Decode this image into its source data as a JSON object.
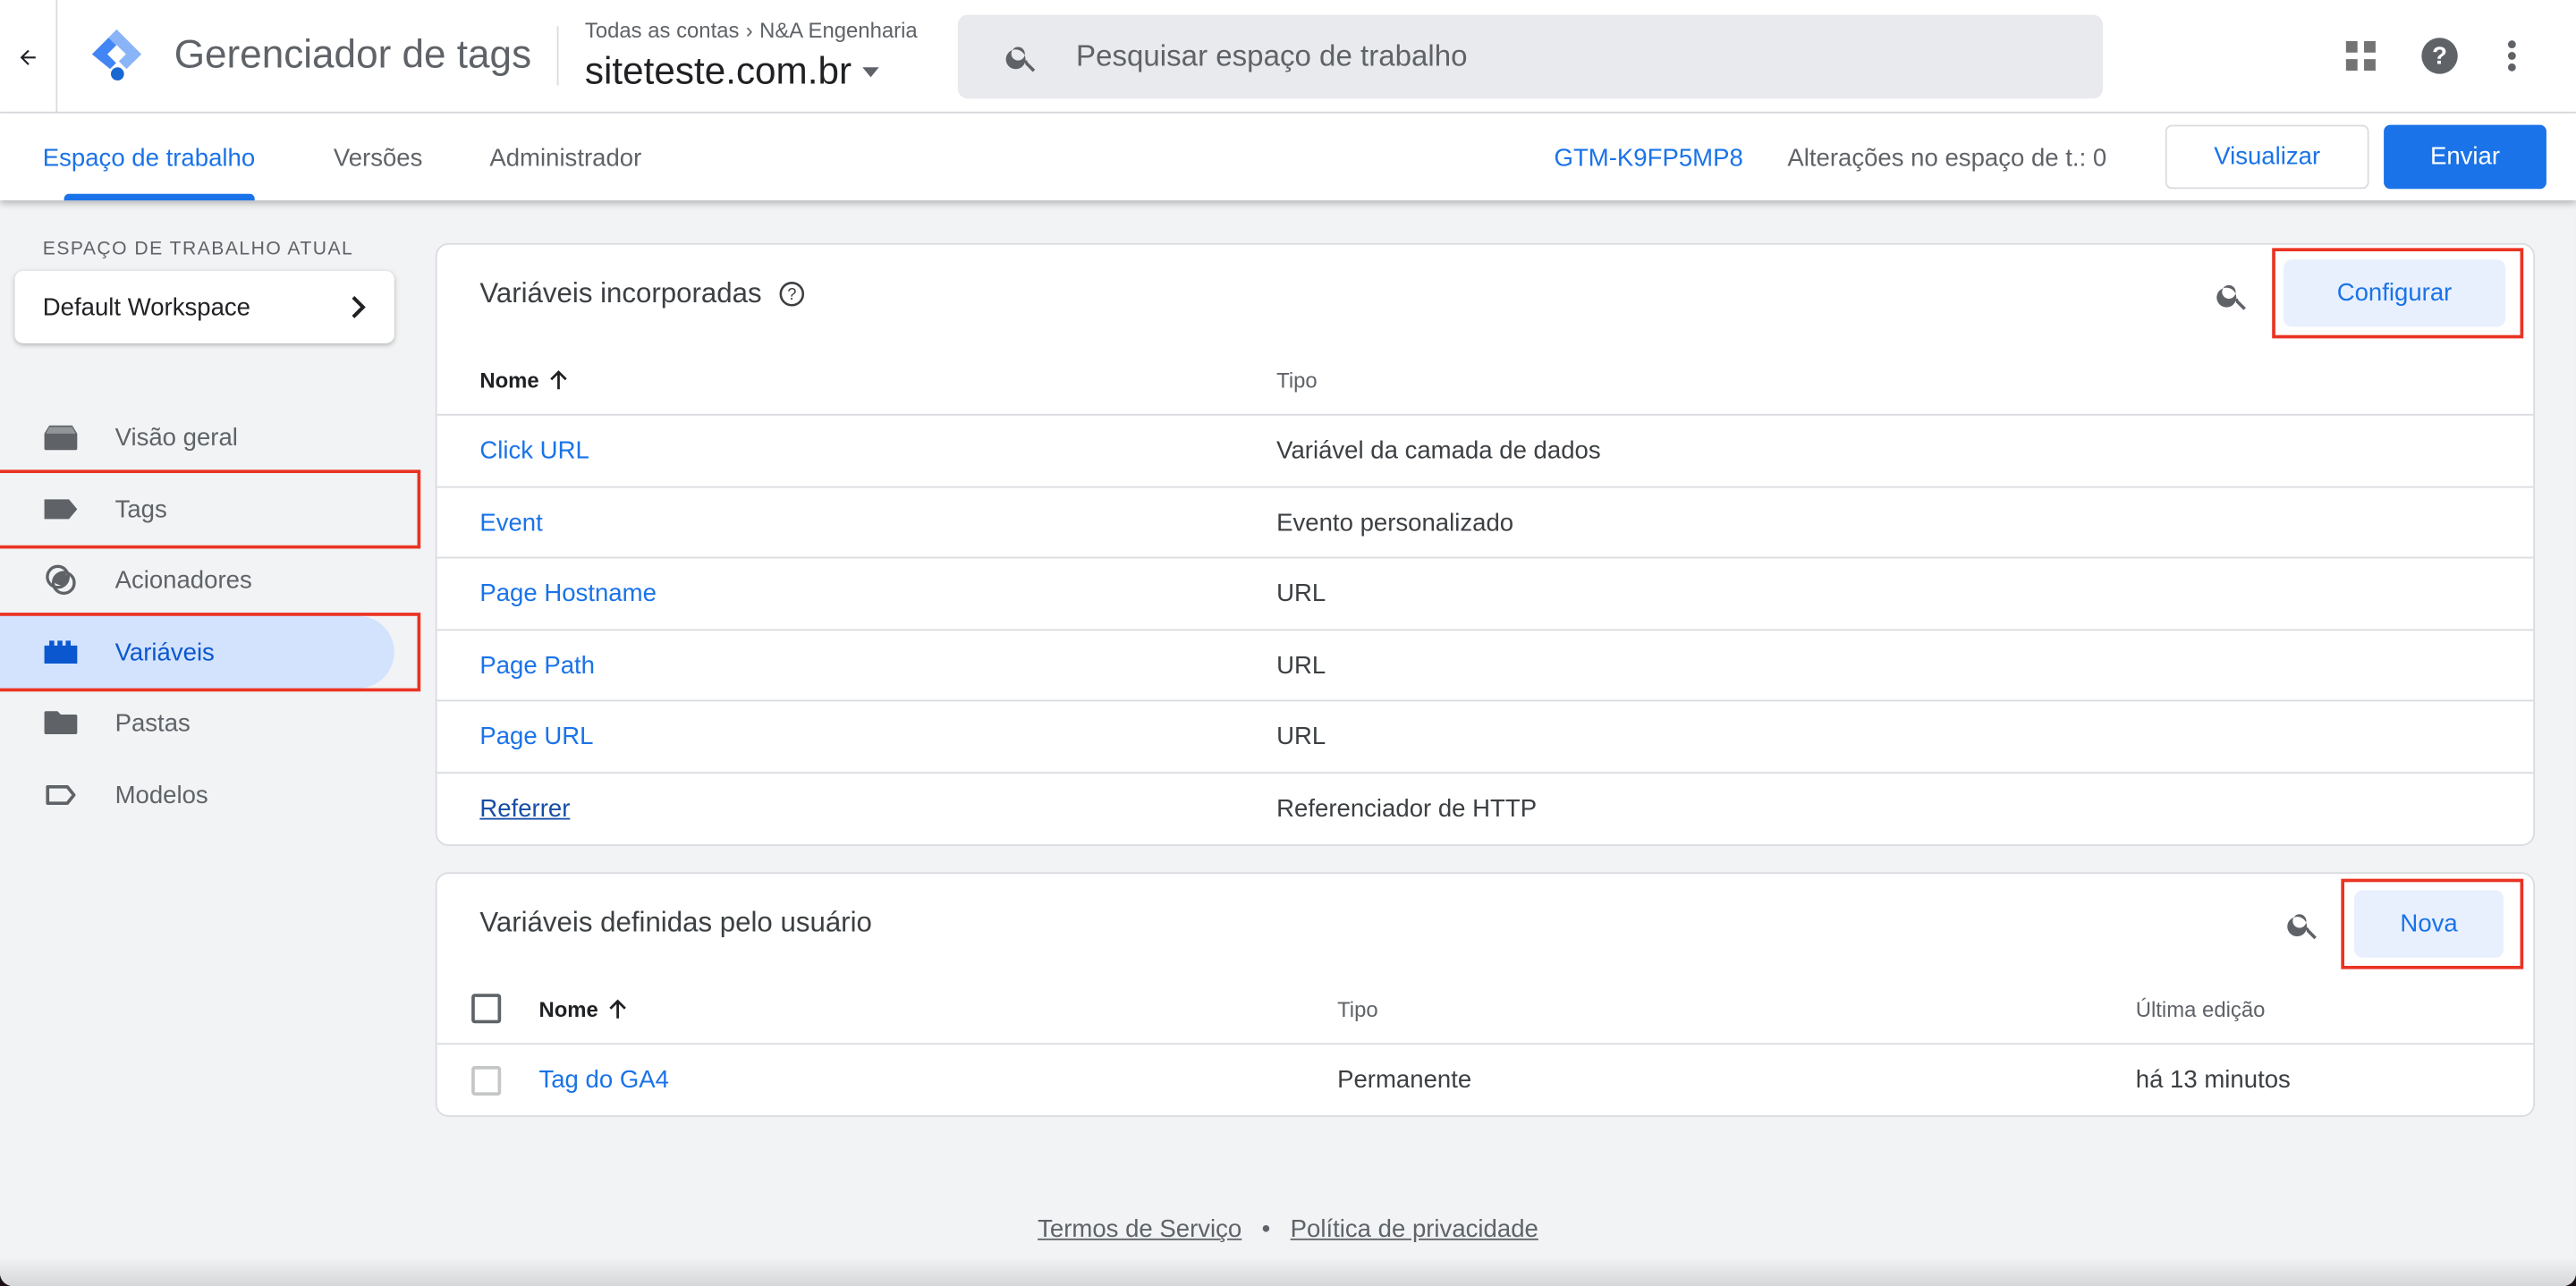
{
  "header": {
    "app_title": "Gerenciador de tags",
    "breadcrumb": {
      "accounts": "Todas as contas",
      "separator": "›",
      "account": "N&A Engenharia"
    },
    "container": "siteteste.com.br",
    "search_placeholder": "Pesquisar espaço de trabalho",
    "icons": {
      "back": "arrow-back-icon",
      "apps": "apps-grid-icon",
      "help": "help-icon",
      "more": "more-vert-icon"
    }
  },
  "subnav": {
    "tabs": [
      {
        "label": "Espaço de trabalho",
        "active": true
      },
      {
        "label": "Versões",
        "active": false
      },
      {
        "label": "Administrador",
        "active": false
      }
    ],
    "container_id": "GTM-K9FP5MP8",
    "workspace_changes": "Alterações no espaço de t.: 0",
    "preview_label": "Visualizar",
    "submit_label": "Enviar"
  },
  "sidebar": {
    "current_workspace_label": "ESPAÇO DE TRABALHO ATUAL",
    "workspace_name": "Default Workspace",
    "items": [
      {
        "label": "Visão geral",
        "icon": "overview-icon",
        "active": false,
        "highlighted": false
      },
      {
        "label": "Tags",
        "icon": "tag-icon",
        "active": false,
        "highlighted": true
      },
      {
        "label": "Acionadores",
        "icon": "trigger-icon",
        "active": false,
        "highlighted": false
      },
      {
        "label": "Variáveis",
        "icon": "variable-icon",
        "active": true,
        "highlighted": true
      },
      {
        "label": "Pastas",
        "icon": "folder-icon",
        "active": false,
        "highlighted": false
      },
      {
        "label": "Modelos",
        "icon": "template-icon",
        "active": false,
        "highlighted": false
      }
    ]
  },
  "builtin": {
    "title": "Variáveis incorporadas",
    "configure_label": "Configurar",
    "columns": {
      "name": "Nome",
      "type": "Tipo"
    },
    "rows": [
      {
        "name": "Click URL",
        "type": "Variável da camada de dados"
      },
      {
        "name": "Event",
        "type": "Evento personalizado"
      },
      {
        "name": "Page Hostname",
        "type": "URL"
      },
      {
        "name": "Page Path",
        "type": "URL"
      },
      {
        "name": "Page URL",
        "type": "URL"
      },
      {
        "name": "Referrer",
        "type": "Referenciador de HTTP"
      }
    ]
  },
  "user_defined": {
    "title": "Variáveis definidas pelo usuário",
    "new_label": "Nova",
    "columns": {
      "name": "Nome",
      "type": "Tipo",
      "last_edited": "Última edição"
    },
    "rows": [
      {
        "name": "Tag do GA4",
        "type": "Permanente",
        "last_edited": "há 13 minutos"
      }
    ]
  },
  "footer": {
    "terms": "Termos de Serviço",
    "separator": "•",
    "privacy": "Política de privacidade"
  },
  "colors": {
    "accent": "#1a73e8",
    "highlight_box": "#ea3323",
    "active_nav_bg": "#d3e3fd"
  }
}
